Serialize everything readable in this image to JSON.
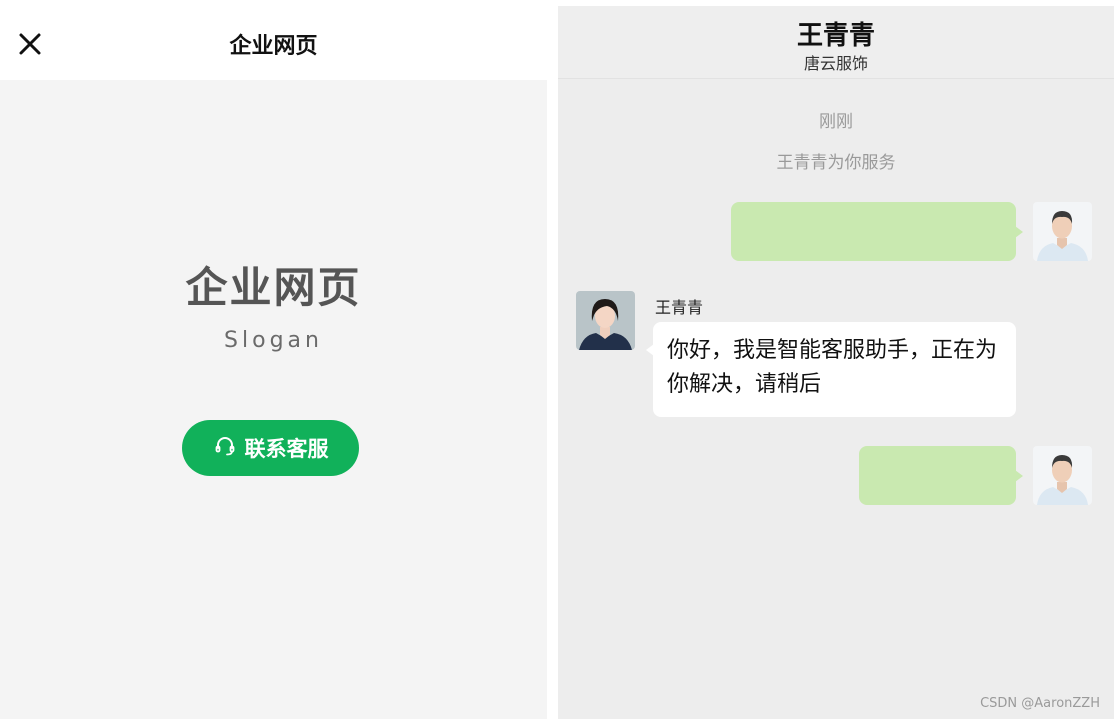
{
  "left_panel": {
    "header_title": "企业网页",
    "enterprise_name": "企业网页",
    "slogan": "Slogan",
    "contact_button_label": "联系客服",
    "icons": {
      "close": "close-icon",
      "headset": "headset-icon"
    },
    "colors": {
      "accent_green": "#11b15a",
      "background": "#f4f4f4"
    }
  },
  "chat": {
    "header": {
      "name": "王青青",
      "subtitle": "唐云服饰"
    },
    "system_time": "刚刚",
    "system_message": "王青青为你服务",
    "messages": [
      {
        "from": "me",
        "text": ""
      },
      {
        "from": "agent",
        "sender": "王青青",
        "text": "你好，我是智能客服助手，正在为你解决，请稍后"
      },
      {
        "from": "me",
        "text": ""
      }
    ],
    "colors": {
      "outgoing_bubble": "#c9e9b0",
      "incoming_bubble": "#ffffff",
      "background": "#ededed"
    }
  },
  "watermark": "CSDN @AaronZZH"
}
